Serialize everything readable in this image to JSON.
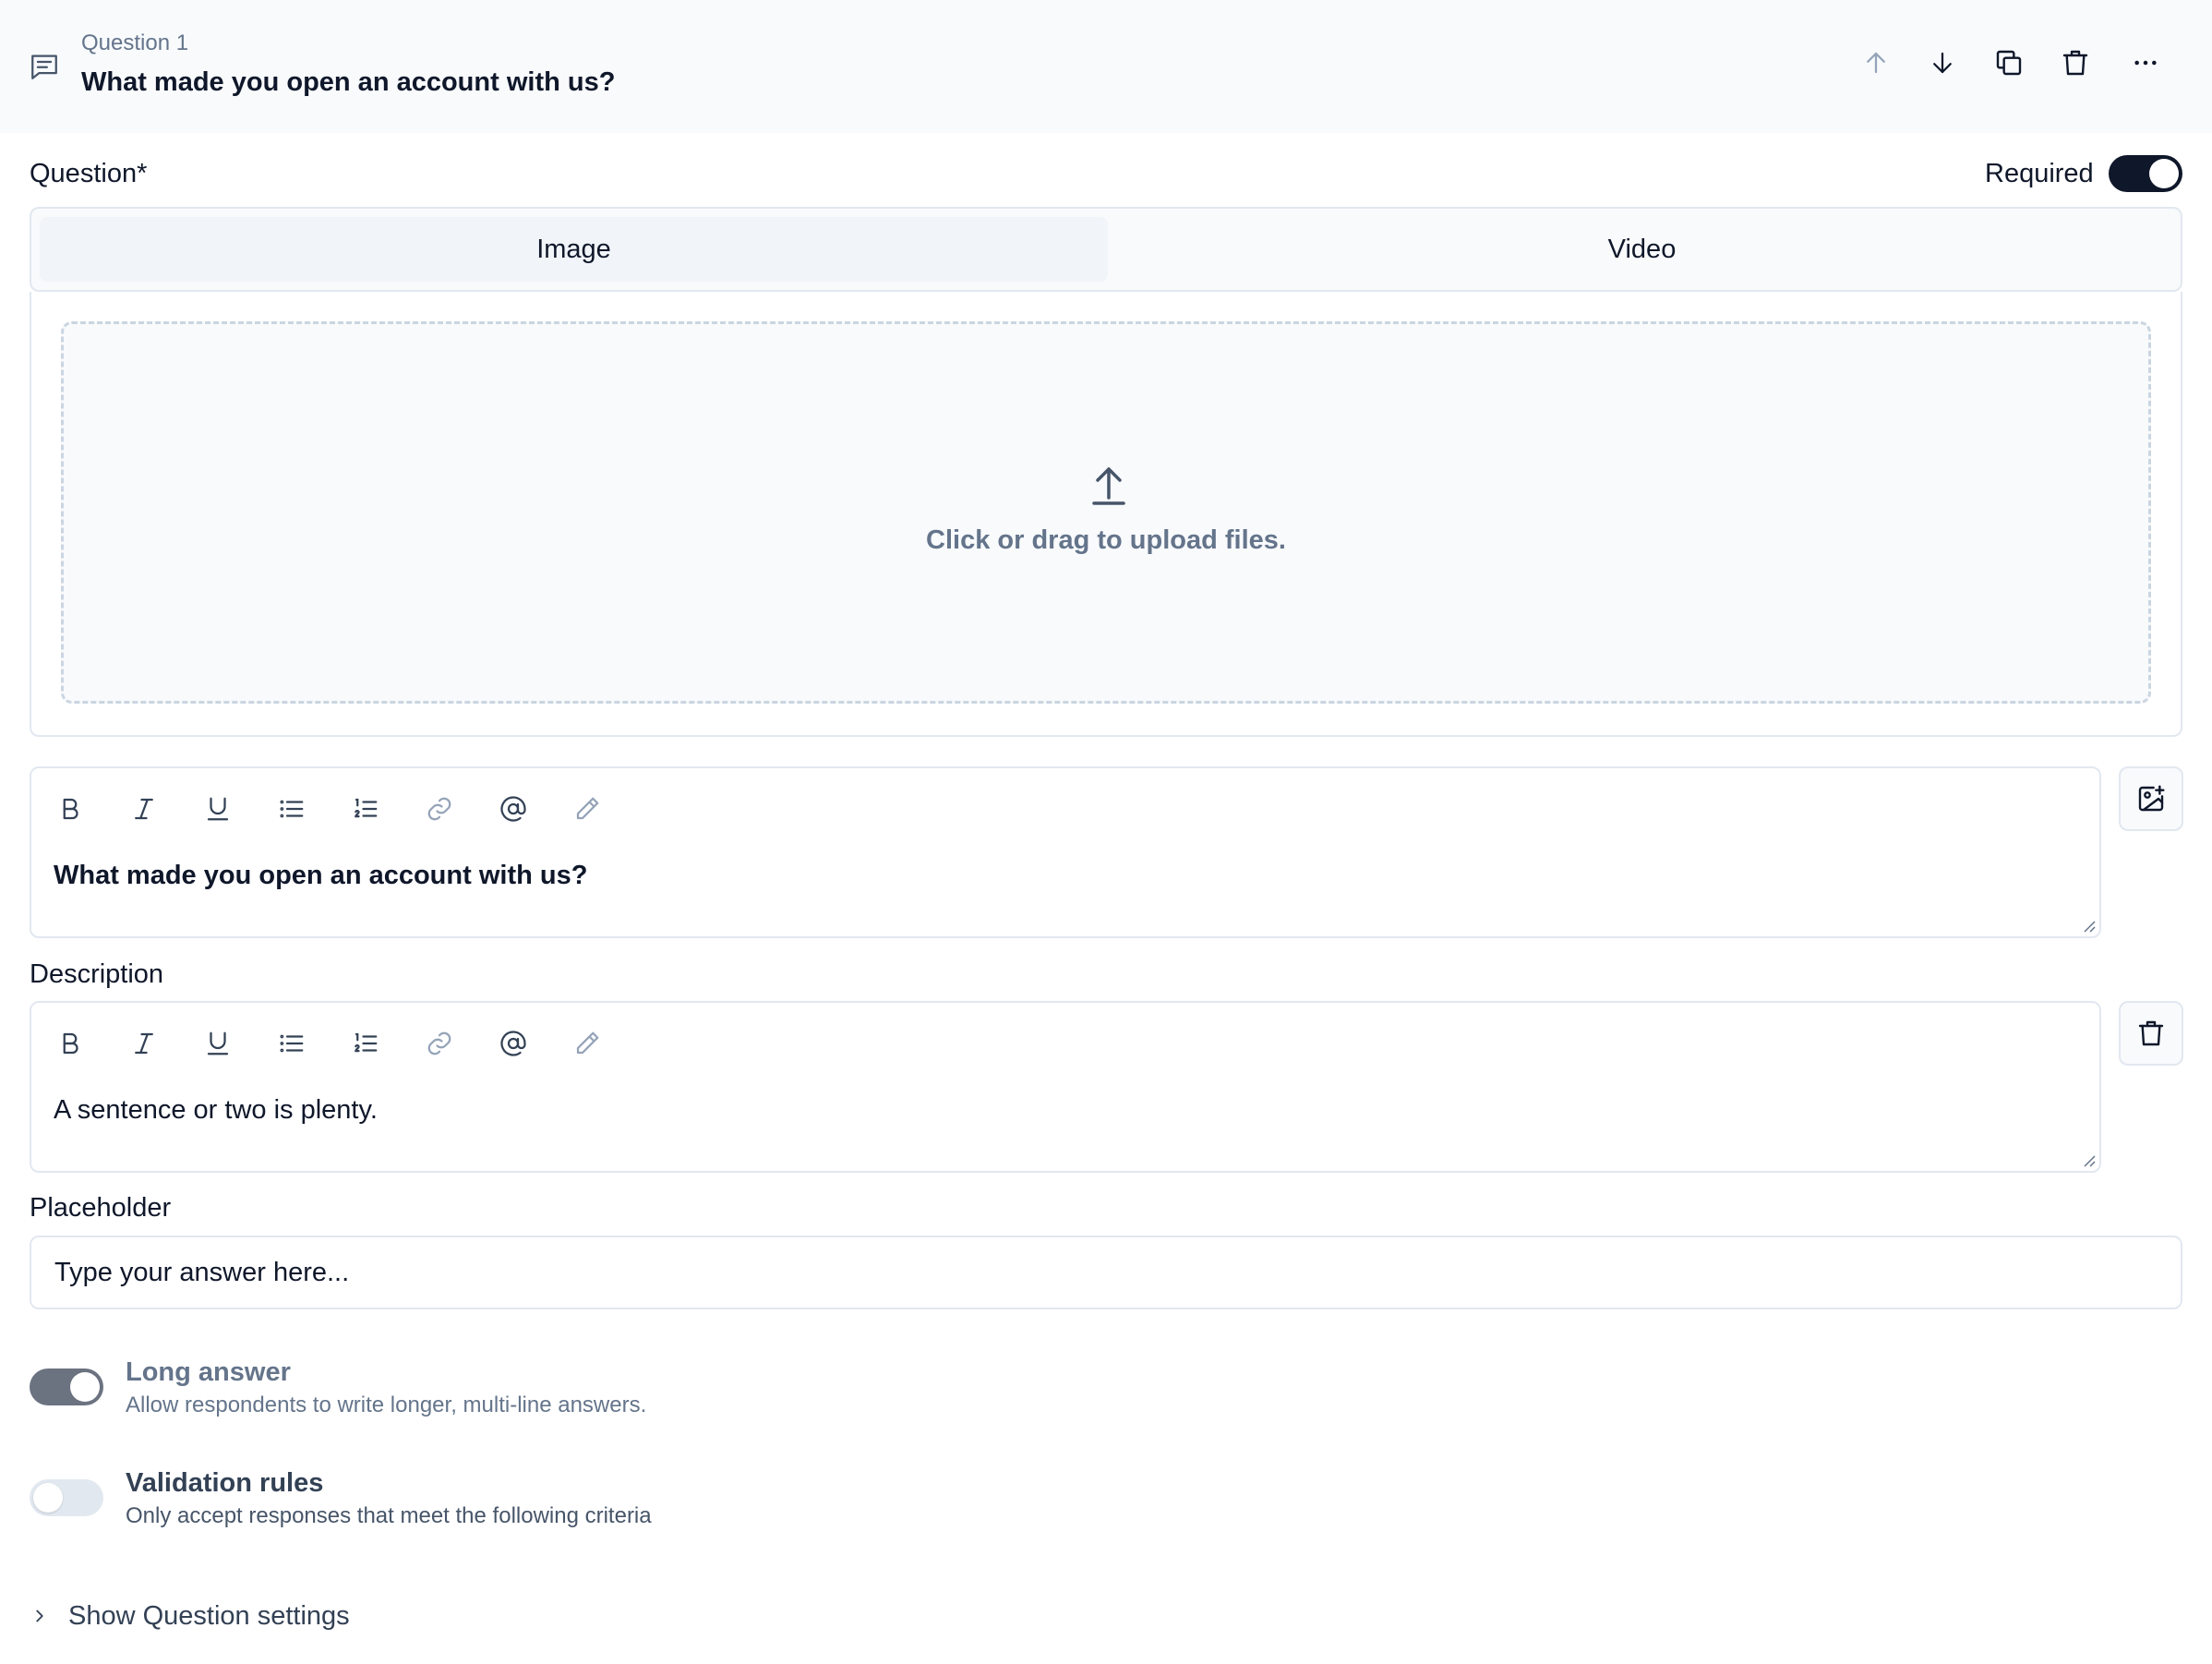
{
  "header": {
    "question_number": "Question 1",
    "question_title": "What made you open an account with us?",
    "actions": [
      "arrow-up-icon",
      "arrow-down-icon",
      "copy-icon",
      "trash-icon",
      "more-icon"
    ]
  },
  "question": {
    "label": "Question*",
    "required_label": "Required",
    "required": true
  },
  "media_tabs": [
    {
      "label": "Image",
      "active": true
    },
    {
      "label": "Video",
      "active": false
    }
  ],
  "upload": {
    "text": "Click or drag to upload files."
  },
  "question_editor": {
    "content": "What made you open an account with us?",
    "toolbar": [
      "bold-icon",
      "italic-icon",
      "underline-icon",
      "bullet-list-icon",
      "numbered-list-icon",
      "link-icon",
      "mention-icon",
      "pen-icon"
    ]
  },
  "description": {
    "label": "Description",
    "content": "A sentence or two is plenty."
  },
  "placeholder": {
    "label": "Placeholder",
    "value": "Type your answer here..."
  },
  "long_answer": {
    "title": "Long answer",
    "description": "Allow respondents to write longer, multi-line answers.",
    "enabled": true
  },
  "validation": {
    "title": "Validation rules",
    "description": "Only accept responses that meet the following criteria",
    "enabled": false
  },
  "settings_toggle": {
    "label": "Show Question settings"
  },
  "colors": {
    "toggle_on": "#0f172a",
    "toggle_disabled_on": "#6b7280",
    "toggle_off": "#e2e8f0",
    "muted_text": "#64748b"
  }
}
